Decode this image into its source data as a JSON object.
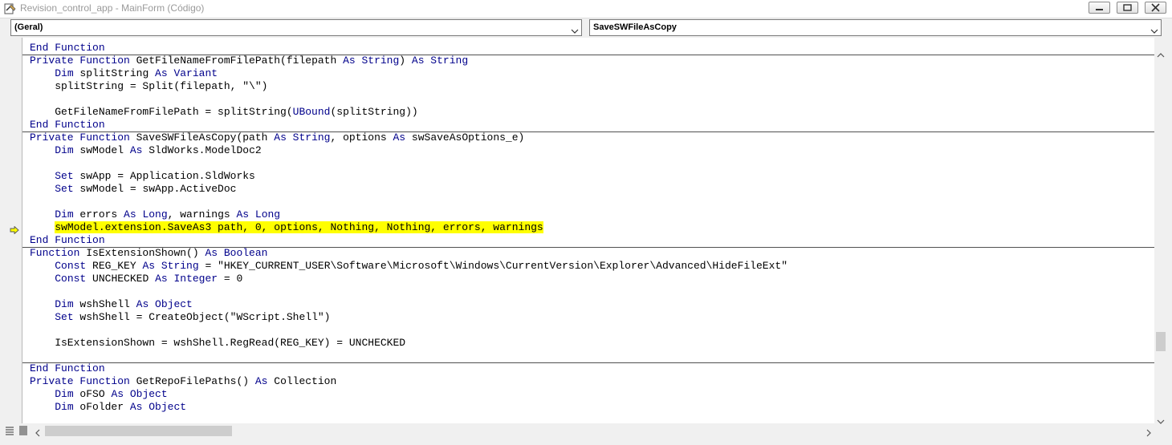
{
  "window": {
    "title": "Revision_control_app - MainForm (Código)",
    "buttons": [
      "minimize",
      "restore",
      "close"
    ]
  },
  "toolbar": {
    "object_combo": "(Geral)",
    "procedure_combo": "SaveSWFileAsCopy"
  },
  "colors": {
    "keyword": "#00008b",
    "highlight": "#ffff00",
    "separator": "#505050"
  },
  "code": {
    "current_line_index": 14,
    "separators_after_lines": [
      0,
      6,
      15,
      24
    ],
    "lines": [
      [
        {
          "k": "k",
          "t": "End Function"
        }
      ],
      [
        {
          "k": "k",
          "t": "Private Function"
        },
        {
          "k": "n",
          "t": " GetFileNameFromFilePath(filepath "
        },
        {
          "k": "k",
          "t": "As String"
        },
        {
          "k": "n",
          "t": ") "
        },
        {
          "k": "k",
          "t": "As String"
        }
      ],
      [
        {
          "k": "n",
          "t": "    "
        },
        {
          "k": "k",
          "t": "Dim"
        },
        {
          "k": "n",
          "t": " splitString "
        },
        {
          "k": "k",
          "t": "As Variant"
        }
      ],
      [
        {
          "k": "n",
          "t": "    splitString = Split(filepath, \"\\\")"
        }
      ],
      [],
      [
        {
          "k": "n",
          "t": "    GetFileNameFromFilePath = splitString("
        },
        {
          "k": "k",
          "t": "UBound"
        },
        {
          "k": "n",
          "t": "(splitString))"
        }
      ],
      [
        {
          "k": "k",
          "t": "End Function"
        }
      ],
      [
        {
          "k": "k",
          "t": "Private Function"
        },
        {
          "k": "n",
          "t": " SaveSWFileAsCopy(path "
        },
        {
          "k": "k",
          "t": "As String"
        },
        {
          "k": "n",
          "t": ", options "
        },
        {
          "k": "k",
          "t": "As"
        },
        {
          "k": "n",
          "t": " swSaveAsOptions_e)"
        }
      ],
      [
        {
          "k": "n",
          "t": "    "
        },
        {
          "k": "k",
          "t": "Dim"
        },
        {
          "k": "n",
          "t": " swModel "
        },
        {
          "k": "k",
          "t": "As"
        },
        {
          "k": "n",
          "t": " SldWorks.ModelDoc2"
        }
      ],
      [],
      [
        {
          "k": "n",
          "t": "    "
        },
        {
          "k": "k",
          "t": "Set"
        },
        {
          "k": "n",
          "t": " swApp = Application.SldWorks"
        }
      ],
      [
        {
          "k": "n",
          "t": "    "
        },
        {
          "k": "k",
          "t": "Set"
        },
        {
          "k": "n",
          "t": " swModel = swApp.ActiveDoc"
        }
      ],
      [],
      [
        {
          "k": "n",
          "t": "    "
        },
        {
          "k": "k",
          "t": "Dim"
        },
        {
          "k": "n",
          "t": " errors "
        },
        {
          "k": "k",
          "t": "As Long"
        },
        {
          "k": "n",
          "t": ", warnings "
        },
        {
          "k": "k",
          "t": "As Long"
        }
      ],
      [
        {
          "k": "n",
          "t": "    "
        },
        {
          "k": "h",
          "t": "swModel.extension.SaveAs3 path, 0, options, Nothing, Nothing, errors, warnings"
        }
      ],
      [
        {
          "k": "k",
          "t": "End Function"
        }
      ],
      [
        {
          "k": "k",
          "t": "Function"
        },
        {
          "k": "n",
          "t": " IsExtensionShown() "
        },
        {
          "k": "k",
          "t": "As Boolean"
        }
      ],
      [
        {
          "k": "n",
          "t": "    "
        },
        {
          "k": "k",
          "t": "Const"
        },
        {
          "k": "n",
          "t": " REG_KEY "
        },
        {
          "k": "k",
          "t": "As String"
        },
        {
          "k": "n",
          "t": " = \"HKEY_CURRENT_USER\\Software\\Microsoft\\Windows\\CurrentVersion\\Explorer\\Advanced\\HideFileExt\""
        }
      ],
      [
        {
          "k": "n",
          "t": "    "
        },
        {
          "k": "k",
          "t": "Const"
        },
        {
          "k": "n",
          "t": " UNCHECKED "
        },
        {
          "k": "k",
          "t": "As Integer"
        },
        {
          "k": "n",
          "t": " = 0"
        }
      ],
      [],
      [
        {
          "k": "n",
          "t": "    "
        },
        {
          "k": "k",
          "t": "Dim"
        },
        {
          "k": "n",
          "t": " wshShell "
        },
        {
          "k": "k",
          "t": "As Object"
        }
      ],
      [
        {
          "k": "n",
          "t": "    "
        },
        {
          "k": "k",
          "t": "Set"
        },
        {
          "k": "n",
          "t": " wshShell = CreateObject(\"WScript.Shell\")"
        }
      ],
      [],
      [
        {
          "k": "n",
          "t": "    IsExtensionShown = wshShell.RegRead(REG_KEY) = UNCHECKED"
        }
      ],
      [],
      [
        {
          "k": "k",
          "t": "End Function"
        }
      ],
      [
        {
          "k": "k",
          "t": "Private Function"
        },
        {
          "k": "n",
          "t": " GetRepoFilePaths() "
        },
        {
          "k": "k",
          "t": "As"
        },
        {
          "k": "n",
          "t": " Collection"
        }
      ],
      [
        {
          "k": "n",
          "t": "    "
        },
        {
          "k": "k",
          "t": "Dim"
        },
        {
          "k": "n",
          "t": " oFSO "
        },
        {
          "k": "k",
          "t": "As Object"
        }
      ],
      [
        {
          "k": "n",
          "t": "    "
        },
        {
          "k": "k",
          "t": "Dim"
        },
        {
          "k": "n",
          "t": " oFolder "
        },
        {
          "k": "k",
          "t": "As Object"
        }
      ]
    ]
  }
}
